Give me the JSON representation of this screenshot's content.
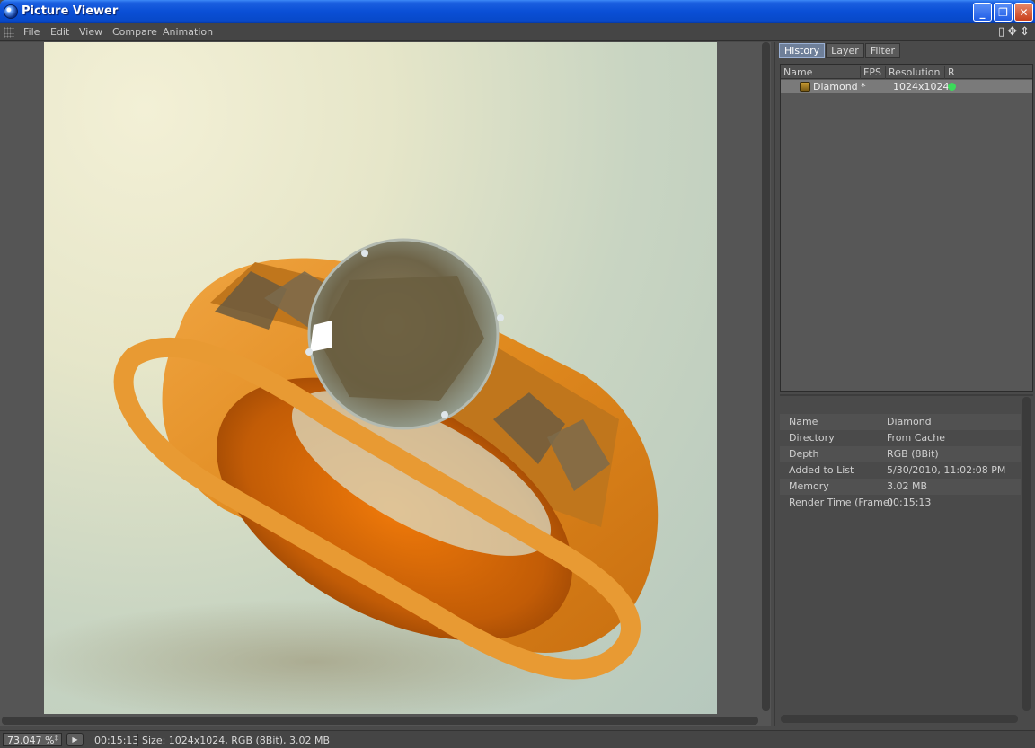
{
  "window": {
    "title": "Picture Viewer",
    "icon": "cinema4d-sphere-icon",
    "buttons": {
      "minimize": "_",
      "maximize": "❐",
      "close": "✕"
    }
  },
  "menu": {
    "items": [
      "File",
      "Edit",
      "View",
      "Compare",
      "Animation"
    ]
  },
  "panel": {
    "tabs": [
      "History",
      "Layer",
      "Filter"
    ],
    "active_tab": "History",
    "columns": [
      "Name",
      "FPS",
      "Resolution",
      "R"
    ],
    "rows": [
      {
        "name": "Diamond *",
        "fps": "",
        "resolution": "1024x1024",
        "status_color": "#3cdb5a"
      }
    ]
  },
  "info": [
    {
      "label": "Name",
      "value": "Diamond"
    },
    {
      "label": "Directory",
      "value": "From Cache"
    },
    {
      "label": "Depth",
      "value": "RGB (8Bit)"
    },
    {
      "label": "Added to List",
      "value": "5/30/2010, 11:02:08 PM"
    },
    {
      "label": "Memory",
      "value": "3.02 MB"
    },
    {
      "label": "Render Time (Frame)",
      "value": "00:15:13"
    }
  ],
  "status": {
    "zoom": "73.047 %",
    "time": "00:15:13",
    "info": "Size: 1024x1024, RGB (8Bit), 3.02 MB"
  },
  "image": {
    "subject": "gold ring with diamonds render",
    "colors": {
      "gold": "#d9861e",
      "background": "#d6dcc6"
    }
  }
}
